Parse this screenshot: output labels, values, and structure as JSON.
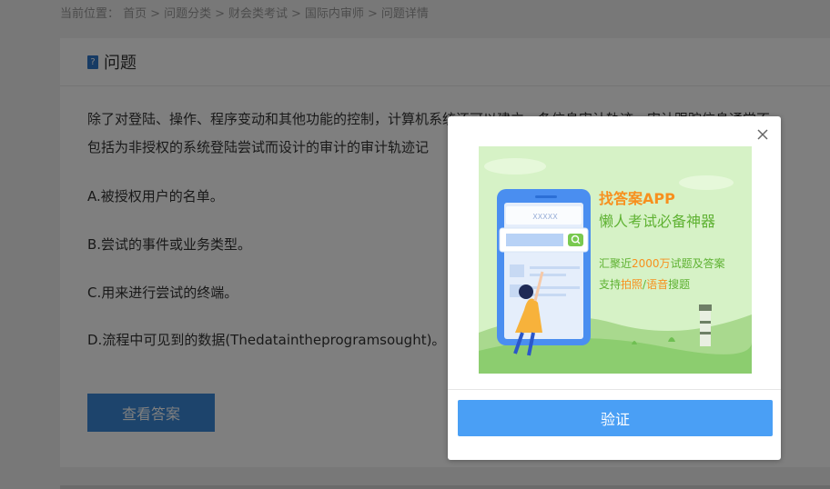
{
  "breadcrumb": {
    "label": "当前位置：",
    "items": [
      "首页",
      "问题分类",
      "财会类考试",
      "国际内审师",
      "问题详情"
    ],
    "separator": ">"
  },
  "question_card": {
    "title": "问题",
    "question_line1": "除了对登陆、操作、程序变动和其他功能的控制，计算机系统还可以建立一条信息审计轨迹，审计跟踪信息通常不",
    "question_line2": "包括为非授权的系统登陆尝试而设计的审计的审计轨迹记",
    "options": [
      "A.被授权用户的名单。",
      "B.尝试的事件或业务类型。",
      "C.用来进行尝试的终端。",
      "D.流程中可见到的数据(Thedataintheprogramsought)。"
    ],
    "answer_button": "查看答案"
  },
  "modal": {
    "ad": {
      "search_text": "XXXXX",
      "headline": "找答案APP",
      "subheadline": "懒人考试必备神器",
      "line1_prefix": "汇聚近",
      "line1_highlight": "2000万",
      "line1_suffix": "试题及答案",
      "line2_prefix": "支持",
      "line2_highlight1": "拍照",
      "line2_sep": "/",
      "line2_highlight2": "语音",
      "line2_suffix": "搜题"
    },
    "verify_button": "验证"
  },
  "colors": {
    "primary_button": "#3a89d9",
    "verify_button": "#4a9ff5",
    "ad_green": "#d6f2c6",
    "headline_orange": "#f7901e",
    "subheadline_green": "#5fb233"
  }
}
